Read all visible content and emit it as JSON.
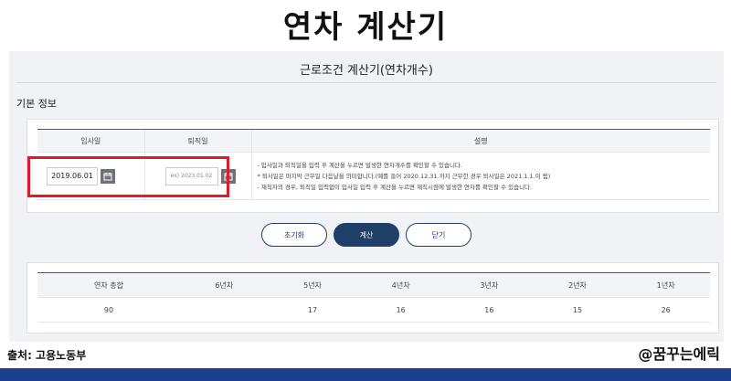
{
  "banner": {
    "title": "연차 계산기"
  },
  "page": {
    "heading": "근로조건 계산기(연차개수)",
    "section_title": "기본 정보"
  },
  "form": {
    "headers": {
      "join_date": "입사일",
      "leave_date": "퇴직일",
      "description": "설명"
    },
    "join_date_value": "2019.06.01",
    "leave_date_placeholder": "ex) 2023.01.02",
    "description_lines": [
      "- 입사일과 퇴직일을 입력 후 계산을 누르면 발생한 연차개수를 확인할 수 있습니다.",
      "* 퇴사일은 마지막 근무일 다음날을 의미합니다.(예를 들어 2020.12.31.까지 근무한 경우 퇴사일은 2021.1.1.이 됨)",
      "- 재직자의 경우, 퇴직일 입력없이 입사일 입력 후 계산을 누르면 재직시점에 발생한 연차를 확인할 수 있습니다."
    ]
  },
  "buttons": {
    "reset": "초기화",
    "calculate": "계산",
    "close": "닫기"
  },
  "result": {
    "headers": [
      "연차 총합",
      "6년차",
      "5년차",
      "4년차",
      "3년차",
      "2년차",
      "1년차"
    ],
    "values": [
      "90",
      "",
      "17",
      "16",
      "16",
      "15",
      "26"
    ]
  },
  "footer": {
    "source": "출처: 고용노동부",
    "handle": "@꿈꾸는에릭"
  },
  "colors": {
    "accent": "#1f3e68",
    "highlight": "#e01c2b",
    "bottom_bar": "#1b3f8c"
  }
}
